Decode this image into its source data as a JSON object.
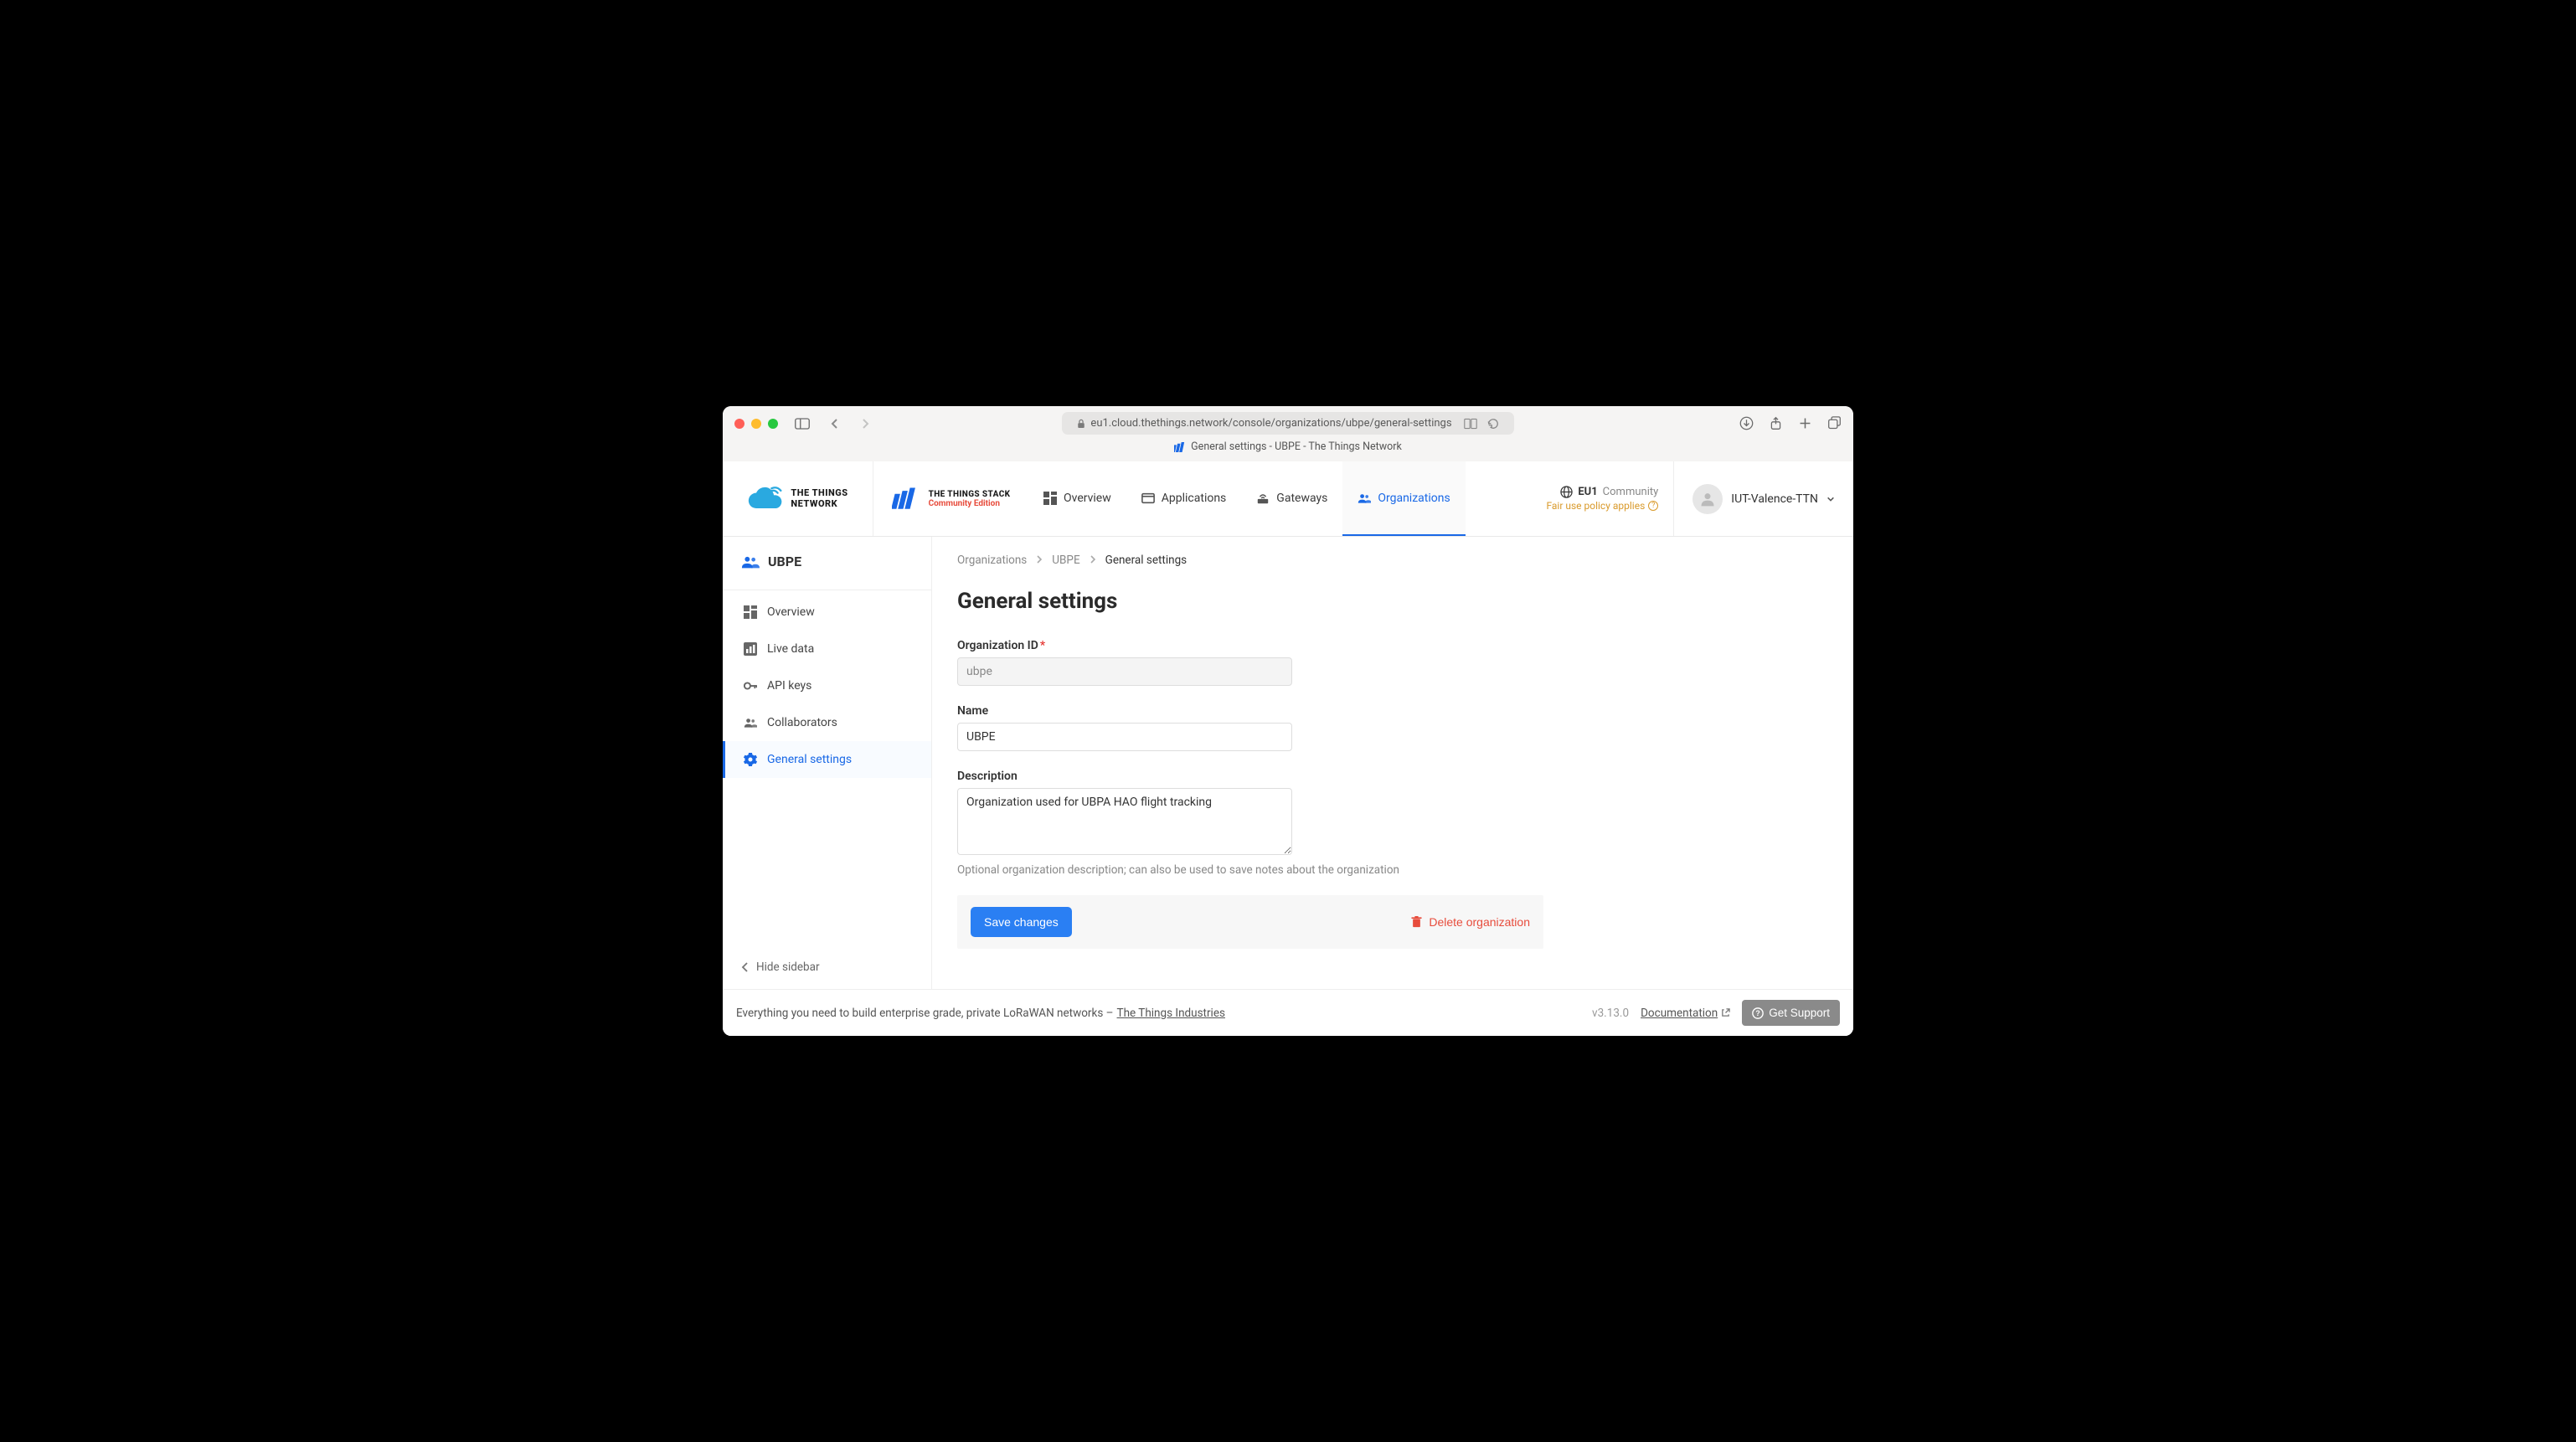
{
  "browser": {
    "url": "eu1.cloud.thethings.network/console/organizations/ubpe/general-settings",
    "tab_title": "General settings - UBPE - The Things Network"
  },
  "brand": {
    "ttn_line1": "THE THINGS",
    "ttn_line2": "NETWORK",
    "stack_line1": "THE THINGS STACK",
    "stack_line2": "Community Edition"
  },
  "nav": {
    "overview": "Overview",
    "applications": "Applications",
    "gateways": "Gateways",
    "organizations": "Organizations"
  },
  "cluster": {
    "id": "EU1",
    "tag": "Community",
    "fair_use": "Fair use policy applies"
  },
  "user": {
    "name": "IUT-Valence-TTN"
  },
  "sidebar": {
    "title": "UBPE",
    "items": {
      "overview": "Overview",
      "live_data": "Live data",
      "api_keys": "API keys",
      "collaborators": "Collaborators",
      "general_settings": "General settings"
    },
    "hide": "Hide sidebar"
  },
  "breadcrumbs": {
    "0": "Organizations",
    "1": "UBPE",
    "2": "General settings"
  },
  "page": {
    "title": "General settings",
    "org_id_label": "Organization ID",
    "org_id_value": "ubpe",
    "name_label": "Name",
    "name_value": "UBPE",
    "desc_label": "Description",
    "desc_value": "Organization used for UBPA HAO flight tracking",
    "desc_hint": "Optional organization description; can also be used to save notes about the organization",
    "save": "Save changes",
    "delete": "Delete organization"
  },
  "footer": {
    "lead": "Everything you need to build enterprise grade, private LoRaWAN networks – ",
    "link": "The Things Industries",
    "version": "v3.13.0",
    "doc": "Documentation",
    "support": "Get Support"
  }
}
